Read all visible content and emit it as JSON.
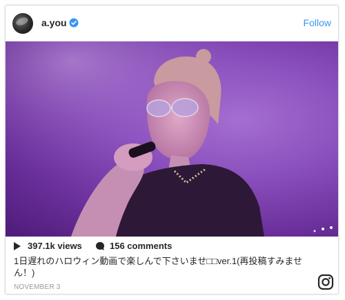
{
  "post": {
    "username": "a.you",
    "follow_label": "Follow",
    "views": "397.1k views",
    "comments": "156 comments",
    "caption": "1日遅れのハロウィン動画で楽しんで下さいませ□□ver.1(再投稿すみません！)",
    "date": "NOVEMBER 3"
  },
  "icons": {
    "avatar": "avatar",
    "verified": "verified-badge-icon",
    "play": "play-icon",
    "comment": "comment-icon",
    "instagram": "instagram-logo-icon"
  },
  "colors": {
    "follow": "#3897f0",
    "verified": "#3897f0",
    "media_bg": "#8a4fbd",
    "date": "#999999"
  }
}
